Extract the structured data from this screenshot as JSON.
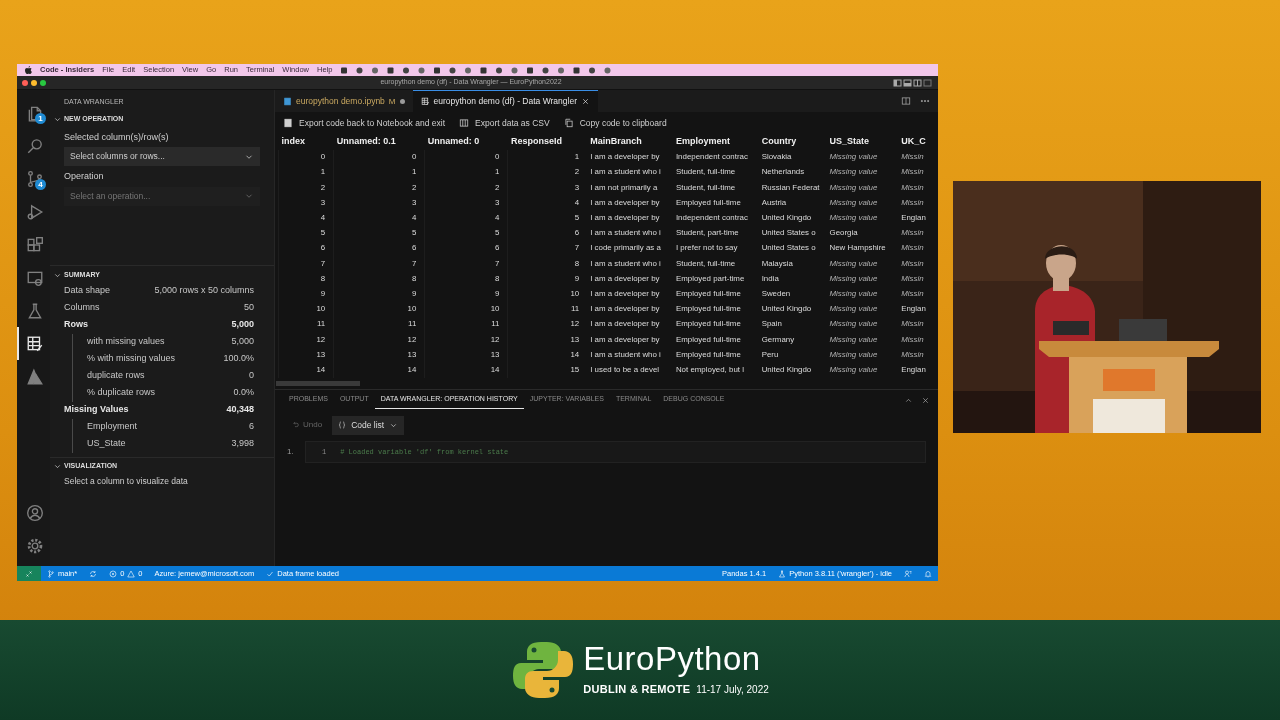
{
  "menu_bar": {
    "app_name": "Code - Insiders",
    "items": [
      "File",
      "Edit",
      "Selection",
      "View",
      "Go",
      "Run",
      "Terminal",
      "Window",
      "Help"
    ]
  },
  "window": {
    "title": "europython demo (df) - Data Wrangler — EuroPython2022"
  },
  "activity_bar": {
    "items": [
      {
        "kind": "explorer",
        "badge": "1",
        "selected": false
      },
      {
        "kind": "search",
        "selected": false
      },
      {
        "kind": "source-control",
        "badge": "4",
        "selected": false
      },
      {
        "kind": "run",
        "selected": false
      },
      {
        "kind": "extensions",
        "selected": false
      },
      {
        "kind": "remote",
        "selected": false
      },
      {
        "kind": "testing",
        "selected": false
      },
      {
        "kind": "wrangler",
        "selected": true
      },
      {
        "kind": "azure",
        "selected": false
      }
    ],
    "bottom": [
      {
        "kind": "account"
      },
      {
        "kind": "settings"
      }
    ]
  },
  "sidebar": {
    "title": "DATA WRANGLER",
    "sections": [
      {
        "kind": "operation",
        "title": "NEW OPERATION",
        "expanded": true,
        "fields": [
          {
            "label": "Selected column(s)/row(s)",
            "placeholder": "Select columns or rows...",
            "disabled": false
          },
          {
            "label": "Operation",
            "placeholder": "Select an operation...",
            "disabled": true
          }
        ]
      },
      {
        "kind": "summary",
        "title": "SUMMARY",
        "expanded": true,
        "stats": [
          {
            "label": "Data shape",
            "value": "5,000 rows x 50 columns"
          },
          {
            "label": "Columns",
            "value": "50"
          },
          {
            "label": "Rows",
            "value": "5,000",
            "children": [
              {
                "label": "with missing values",
                "value": "5,000"
              },
              {
                "label": "% with missing values",
                "value": "100.0%"
              },
              {
                "label": "duplicate rows",
                "value": "0"
              },
              {
                "label": "% duplicate rows",
                "value": "0.0%"
              }
            ]
          },
          {
            "label": "Missing Values",
            "value": "40,348",
            "children": [
              {
                "label": "Employment",
                "value": "6"
              },
              {
                "label": "US_State",
                "value": "3,998"
              }
            ]
          }
        ]
      },
      {
        "kind": "visualization",
        "title": "VISUALIZATION",
        "expanded": true,
        "text": "Select a column to visualize data"
      }
    ]
  },
  "tabs": [
    {
      "kind": "notebook",
      "label": "europython demo.ipynb",
      "badge": "M",
      "modified": true,
      "selected": false
    },
    {
      "kind": "wrangler",
      "label": "europython demo (df) - Data Wrangler",
      "modified": false,
      "selected": true
    }
  ],
  "toolbar": [
    {
      "kind": "notebook",
      "label": "Export code back to Notebook and exit"
    },
    {
      "kind": "csv",
      "label": "Export data as CSV"
    },
    {
      "kind": "copy",
      "label": "Copy code to clipboard"
    }
  ],
  "table": {
    "columns": [
      {
        "name": "index",
        "numeric": true
      },
      {
        "name": "Unnamed: 0.1",
        "numeric": true
      },
      {
        "name": "Unnamed: 0",
        "numeric": true
      },
      {
        "name": "ResponseId",
        "numeric": true
      },
      {
        "name": "MainBranch",
        "numeric": false
      },
      {
        "name": "Employment",
        "numeric": false
      },
      {
        "name": "Country",
        "numeric": false
      },
      {
        "name": "US_State",
        "numeric": false
      },
      {
        "name": "UK_C",
        "numeric": false
      }
    ],
    "rows": [
      [
        "0",
        "0",
        "0",
        "1",
        "I am a developer by",
        "Independent contrac",
        "Slovakia",
        {
          "text": "Missing value",
          "missing": true
        },
        {
          "text": "Missin",
          "missing": true
        }
      ],
      [
        "1",
        "1",
        "1",
        "2",
        "I am a student who i",
        "Student, full-time",
        "Netherlands",
        {
          "text": "Missing value",
          "missing": true
        },
        {
          "text": "Missin",
          "missing": true
        }
      ],
      [
        "2",
        "2",
        "2",
        "3",
        "I am not primarily a",
        "Student, full-time",
        "Russian Federat",
        {
          "text": "Missing value",
          "missing": true
        },
        {
          "text": "Missin",
          "missing": true
        }
      ],
      [
        "3",
        "3",
        "3",
        "4",
        "I am a developer by",
        "Employed full-time",
        "Austria",
        {
          "text": "Missing value",
          "missing": true
        },
        {
          "text": "Missin",
          "missing": true
        }
      ],
      [
        "4",
        "4",
        "4",
        "5",
        "I am a developer by",
        "Independent contrac",
        "United Kingdo",
        {
          "text": "Missing value",
          "missing": true
        },
        "Englan"
      ],
      [
        "5",
        "5",
        "5",
        "6",
        "I am a student who i",
        "Student, part-time",
        "United States o",
        "Georgia",
        {
          "text": "Missin",
          "missing": true
        }
      ],
      [
        "6",
        "6",
        "6",
        "7",
        "I code primarily as a",
        "I prefer not to say",
        "United States o",
        "New Hampshire",
        {
          "text": "Missin",
          "missing": true
        }
      ],
      [
        "7",
        "7",
        "7",
        "8",
        "I am a student who i",
        "Student, full-time",
        "Malaysia",
        {
          "text": "Missing value",
          "missing": true
        },
        {
          "text": "Missin",
          "missing": true
        }
      ],
      [
        "8",
        "8",
        "8",
        "9",
        "I am a developer by",
        "Employed part-time",
        "India",
        {
          "text": "Missing value",
          "missing": true
        },
        {
          "text": "Missin",
          "missing": true
        }
      ],
      [
        "9",
        "9",
        "9",
        "10",
        "I am a developer by",
        "Employed full-time",
        "Sweden",
        {
          "text": "Missing value",
          "missing": true
        },
        {
          "text": "Missin",
          "missing": true
        }
      ],
      [
        "10",
        "10",
        "10",
        "11",
        "I am a developer by",
        "Employed full-time",
        "United Kingdo",
        {
          "text": "Missing value",
          "missing": true
        },
        "Englan"
      ],
      [
        "11",
        "11",
        "11",
        "12",
        "I am a developer by",
        "Employed full-time",
        "Spain",
        {
          "text": "Missing value",
          "missing": true
        },
        {
          "text": "Missin",
          "missing": true
        }
      ],
      [
        "12",
        "12",
        "12",
        "13",
        "I am a developer by",
        "Employed full-time",
        "Germany",
        {
          "text": "Missing value",
          "missing": true
        },
        {
          "text": "Missin",
          "missing": true
        }
      ],
      [
        "13",
        "13",
        "13",
        "14",
        "I am a student who i",
        "Employed full-time",
        "Peru",
        {
          "text": "Missing value",
          "missing": true
        },
        {
          "text": "Missin",
          "missing": true
        }
      ],
      [
        "14",
        "14",
        "14",
        "15",
        "I used to be a devel",
        "Not employed, but l",
        "United Kingdo",
        {
          "text": "Missing value",
          "missing": true
        },
        "Englan"
      ]
    ]
  },
  "panel": {
    "tabs": [
      {
        "label": "PROBLEMS",
        "selected": false
      },
      {
        "label": "OUTPUT",
        "selected": false
      },
      {
        "label": "DATA WRANGLER: OPERATION HISTORY",
        "selected": true
      },
      {
        "label": "JUPYTER: VARIABLES",
        "selected": false
      },
      {
        "label": "TERMINAL",
        "selected": false
      },
      {
        "label": "DEBUG CONSOLE",
        "selected": false
      }
    ],
    "undo": {
      "label": "Undo",
      "disabled": true
    },
    "view_menu": {
      "label": "Code list"
    },
    "entries": [
      {
        "number": "1.",
        "lines": [
          {
            "line": "1",
            "code": "# Loaded variable 'df' from kernel state"
          }
        ]
      }
    ]
  },
  "status_bar": {
    "left": [
      {
        "kind": "remote"
      },
      {
        "kind": "branch",
        "label": "main*"
      },
      {
        "kind": "sync"
      },
      {
        "kind": "problems",
        "errors": "0",
        "warnings": "0"
      },
      {
        "kind": "text",
        "label": "Azure: jemew@microsoft.com"
      },
      {
        "kind": "check",
        "label": "Data frame loaded"
      }
    ],
    "right": [
      {
        "kind": "text",
        "label": "Pandas 1.4.1"
      },
      {
        "kind": "kernel",
        "label": "Python 3.8.11 ('wrangler') - idle"
      },
      {
        "kind": "feedback"
      },
      {
        "kind": "bell"
      }
    ]
  },
  "banner": {
    "title": "EuroPython",
    "location": "DUBLIN & REMOTE",
    "dates": "11-17 July, 2022"
  }
}
